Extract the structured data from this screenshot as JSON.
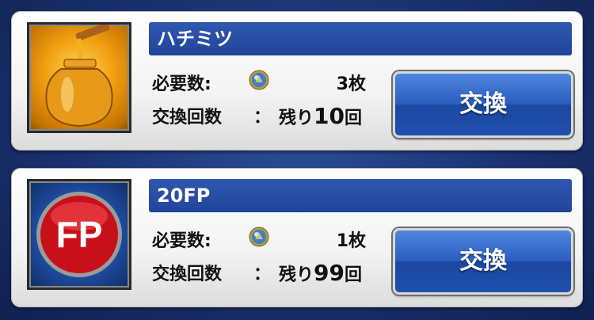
{
  "items": [
    {
      "name": "ハチミツ",
      "icon": "honey-jar-icon",
      "required_label": "必要数:",
      "currency_icon": "medal-coin-icon",
      "required_value": "3枚",
      "count_label": "交換回数",
      "colon": "：",
      "remaining_prefix": "残り",
      "remaining_number": "10",
      "remaining_suffix": "回",
      "button_label": "交換"
    },
    {
      "name": "20FP",
      "icon": "fp-badge-icon",
      "icon_text": "FP",
      "required_label": "必要数:",
      "currency_icon": "medal-coin-icon",
      "required_value": "1枚",
      "count_label": "交換回数",
      "colon": "：",
      "remaining_prefix": "残り",
      "remaining_number": "99",
      "remaining_suffix": "回",
      "button_label": "交換"
    }
  ],
  "colors": {
    "background": "#1a3170",
    "title_bar": "#2a50a8",
    "button": "#2a5fc0"
  }
}
